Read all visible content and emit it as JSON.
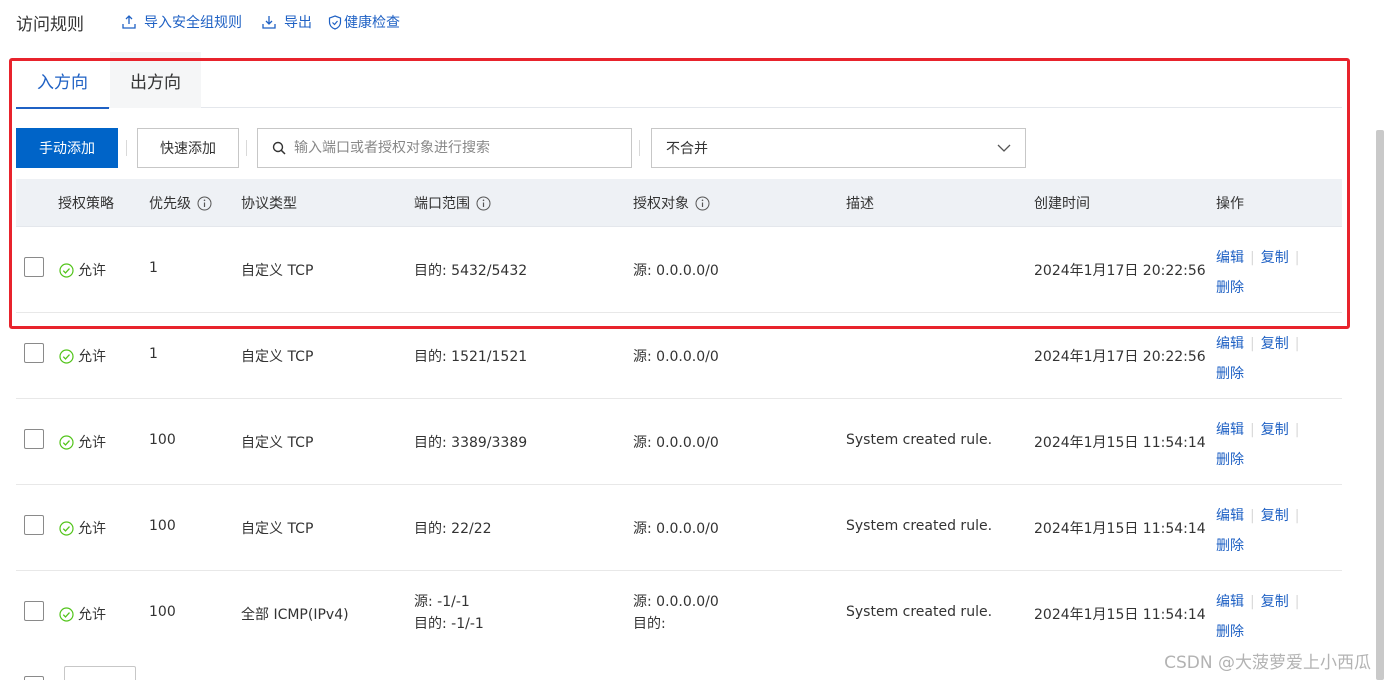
{
  "header": {
    "title": "访问规则",
    "links": [
      {
        "label": "导入安全组规则",
        "icon": "upload-icon"
      },
      {
        "label": "导出",
        "icon": "download-icon"
      },
      {
        "label": "健康检查",
        "icon": "shield-check-icon"
      }
    ]
  },
  "tabs": [
    {
      "label": "入方向",
      "active": true
    },
    {
      "label": "出方向",
      "active": false
    }
  ],
  "toolbar": {
    "manual_add": "手动添加",
    "quick_add": "快速添加",
    "search_placeholder": "输入端口或者授权对象进行搜索",
    "merge_select": "不合并"
  },
  "table": {
    "columns": {
      "policy": "授权策略",
      "priority": "优先级",
      "protocol": "协议类型",
      "port": "端口范围",
      "target": "授权对象",
      "desc": "描述",
      "created": "创建时间",
      "ops": "操作"
    },
    "rows": [
      {
        "policy": "允许",
        "priority": "1",
        "protocol": "自定义 TCP",
        "port": [
          "目的: 5432/5432"
        ],
        "target": [
          "源: 0.0.0.0/0"
        ],
        "desc": "",
        "created": "2024年1月17日 20:22:56"
      },
      {
        "policy": "允许",
        "priority": "1",
        "protocol": "自定义 TCP",
        "port": [
          "目的: 1521/1521"
        ],
        "target": [
          "源: 0.0.0.0/0"
        ],
        "desc": "",
        "created": "2024年1月17日 20:22:56"
      },
      {
        "policy": "允许",
        "priority": "100",
        "protocol": "自定义 TCP",
        "port": [
          "目的: 3389/3389"
        ],
        "target": [
          "源: 0.0.0.0/0"
        ],
        "desc": "System created rule.",
        "created": "2024年1月15日 11:54:14"
      },
      {
        "policy": "允许",
        "priority": "100",
        "protocol": "自定义 TCP",
        "port": [
          "目的: 22/22"
        ],
        "target": [
          "源: 0.0.0.0/0"
        ],
        "desc": "System created rule.",
        "created": "2024年1月15日 11:54:14"
      },
      {
        "policy": "允许",
        "priority": "100",
        "protocol": "全部 ICMP(IPv4)",
        "port": [
          "源: -1/-1",
          "目的: -1/-1"
        ],
        "target": [
          "源: 0.0.0.0/0",
          "目的:"
        ],
        "desc": "System created rule.",
        "created": "2024年1月15日 11:54:14"
      }
    ],
    "actions": {
      "edit": "编辑",
      "copy": "复制",
      "delete": "删除"
    }
  },
  "colors": {
    "accent": "#1f61c4",
    "primary_button": "#0064c8",
    "allow_icon": "#52c41a",
    "highlight": "#e8232c"
  },
  "watermark": "CSDN @大菠萝爱上小西瓜"
}
